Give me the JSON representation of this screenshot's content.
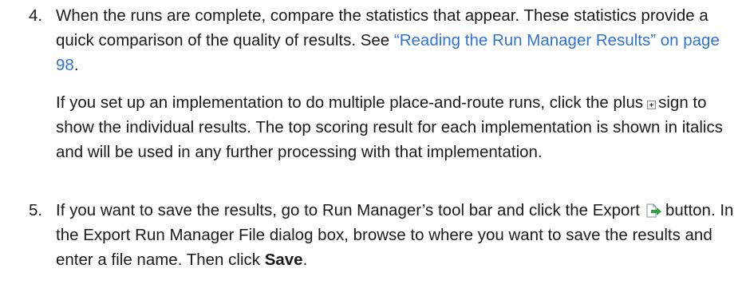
{
  "step4": {
    "number": "4.",
    "intro": "When the runs are complete, compare the statistics that appear. These statistics provide a quick comparison of the quality of results. See ",
    "link": "“Reading the Run Manager Results” on page 98",
    "intro_end": ".",
    "para2_part1": "If you set up an implementation to do multiple place-and-route runs, click the plus",
    "plus_icon": "plus-icon",
    "para2_part2": "sign to show the individual results. The top scoring result for each implementation is shown in italics and will be used in any further processing with that implementation."
  },
  "step5": {
    "number": "5.",
    "part1": "If you want to save the results, go to Run Manager’s tool bar and click the Export",
    "export_icon": "export-icon",
    "part2": "button. In the Export Run Manager File dialog box, browse to where you want to save the results and enter a file name. Then click ",
    "save": "Save",
    "end": "."
  },
  "colors": {
    "link": "#2f73d8",
    "text": "#1a1a1a",
    "export_icon_green": "#2e9e3e"
  }
}
